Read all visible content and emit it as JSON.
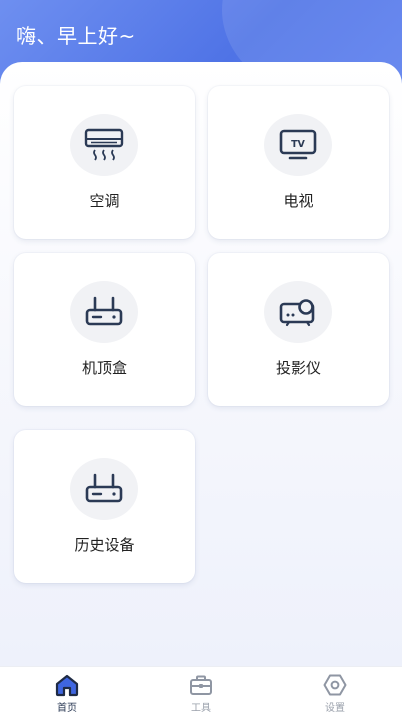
{
  "header": {
    "greeting": "嗨、早上好~"
  },
  "devices": [
    {
      "label": "空调",
      "icon": "air-conditioner-icon"
    },
    {
      "label": "电视",
      "icon": "tv-icon",
      "icon_text": "TV"
    },
    {
      "label": "机顶盒",
      "icon": "set-top-box-icon"
    },
    {
      "label": "投影仪",
      "icon": "projector-icon"
    },
    {
      "label": "历史设备",
      "icon": "router-icon"
    }
  ],
  "tabbar": {
    "tabs": [
      {
        "label": "首页",
        "icon": "home-icon",
        "active": true
      },
      {
        "label": "工具",
        "icon": "toolbox-icon",
        "active": false
      },
      {
        "label": "设置",
        "icon": "settings-hexagon-icon",
        "active": false
      }
    ]
  },
  "colors": {
    "header_gradient_start": "#6e8ff0",
    "header_gradient_end": "#4f73e6",
    "icon_stroke": "#2b3a55",
    "tab_active": "#2b3a55",
    "tab_inactive": "#9aa0ab"
  }
}
